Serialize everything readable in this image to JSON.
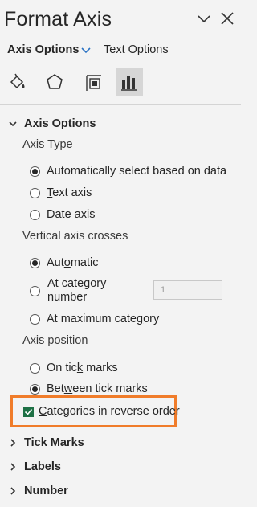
{
  "header": {
    "title": "Format Axis",
    "collapse_icon": "chevron-down-icon",
    "close_icon": "close-icon"
  },
  "tabs": {
    "active": "Axis Options",
    "other": "Text Options"
  },
  "icon_row": [
    "fill-line-icon",
    "effects-pentagon-icon",
    "size-properties-icon",
    "axis-options-chart-icon"
  ],
  "axis_options": {
    "heading": "Axis Options",
    "axis_type_label": "Axis Type",
    "axis_type_options": [
      {
        "pre": "Automatically",
        "acc": "",
        "post": " select based on data",
        "checked": true
      },
      {
        "pre": "",
        "acc": "T",
        "post": "ext axis",
        "checked": false
      },
      {
        "pre": "Date a",
        "acc": "x",
        "post": "is",
        "checked": false
      }
    ],
    "vertical_crosses_label": "Vertical axis crosses",
    "cross_automatic": {
      "pre": "Aut",
      "acc": "o",
      "post": "matic",
      "checked": true
    },
    "cross_category": {
      "line1_pre": "At cate",
      "line1_acc": "g",
      "line1_post": "ory",
      "line2": "number",
      "checked": false,
      "value": "1"
    },
    "cross_max": {
      "pre": "At maximum cate",
      "acc": "g",
      "post": "ory",
      "checked": false
    },
    "axis_position_label": "Axis position",
    "position_options": [
      {
        "pre": "On tic",
        "acc": "k",
        "post": " marks",
        "checked": false
      },
      {
        "pre": "Bet",
        "acc": "w",
        "post": "een tick marks",
        "checked": true
      }
    ],
    "reverse": {
      "pre": "",
      "acc": "C",
      "post": "ategories in reverse order",
      "checked": true
    }
  },
  "sections": [
    "Tick Marks",
    "Labels",
    "Number"
  ],
  "colors": {
    "accent_checkbox": "#1e7145",
    "highlight": "#f07c2a",
    "tab_chevron": "#2b73c4"
  }
}
